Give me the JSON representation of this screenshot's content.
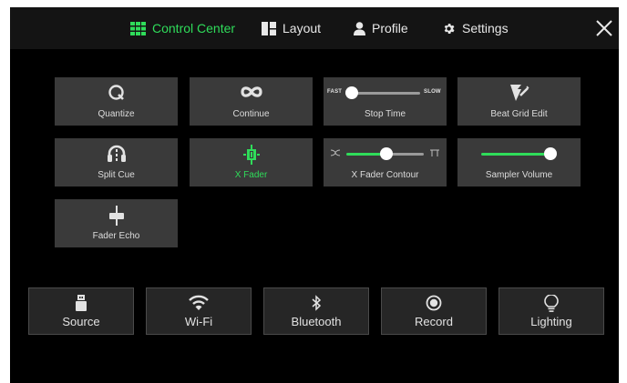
{
  "colors": {
    "accent": "#2fdc5a",
    "tile_bg": "#3a3a3a",
    "bottom_tile_bg": "#262626",
    "screen_bg": "#000000"
  },
  "tabs": [
    {
      "label": "Control Center",
      "icon": "grid-icon",
      "active": true
    },
    {
      "label": "Layout",
      "icon": "layout-icon",
      "active": false
    },
    {
      "label": "Profile",
      "icon": "person-icon",
      "active": false
    },
    {
      "label": "Settings",
      "icon": "gear-icon",
      "active": false
    }
  ],
  "close_icon": "close-icon",
  "tiles": {
    "quantize": {
      "label": "Quantize",
      "icon": "quantize-icon"
    },
    "continue": {
      "label": "Continue",
      "icon": "infinity-icon"
    },
    "stop_time": {
      "label": "Stop Time",
      "left_label": "FAST",
      "right_label": "SLOW",
      "value": 0.0
    },
    "beat_grid_edit": {
      "label": "Beat Grid Edit",
      "icon": "beat-grid-edit-icon"
    },
    "split_cue": {
      "label": "Split Cue",
      "icon": "headphones-icon"
    },
    "x_fader": {
      "label": "X Fader",
      "icon": "crossfader-icon",
      "active": true
    },
    "x_fader_contour": {
      "label": "X Fader Contour",
      "value": 0.5
    },
    "sampler_volume": {
      "label": "Sampler Volume",
      "value": 1.0
    },
    "fader_echo": {
      "label": "Fader Echo",
      "icon": "fader-icon"
    }
  },
  "bottom": [
    {
      "label": "Source",
      "icon": "usb-drive-icon"
    },
    {
      "label": "Wi-Fi",
      "icon": "wifi-icon"
    },
    {
      "label": "Bluetooth",
      "icon": "bluetooth-icon"
    },
    {
      "label": "Record",
      "icon": "record-icon"
    },
    {
      "label": "Lighting",
      "icon": "lightbulb-icon"
    }
  ]
}
